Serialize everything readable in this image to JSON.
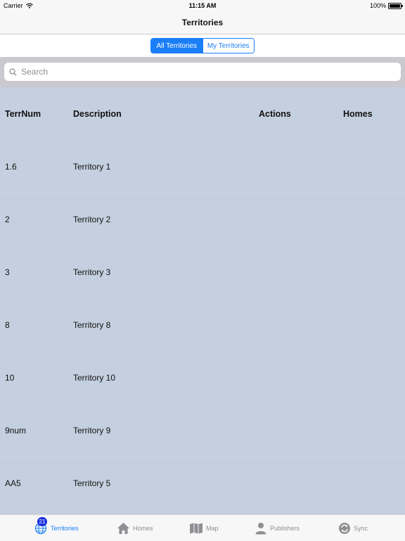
{
  "status_bar": {
    "carrier": "Carrier",
    "time": "11:15 AM",
    "battery": "100%"
  },
  "nav": {
    "title": "Territories"
  },
  "segments": [
    {
      "label": "All Territories",
      "selected": true
    },
    {
      "label": "My Territories",
      "selected": false
    }
  ],
  "search": {
    "placeholder": "Search",
    "value": ""
  },
  "table": {
    "headers": {
      "terrnum": "TerrNum",
      "description": "Description",
      "actions": "Actions",
      "homes": "Homes"
    },
    "rows": [
      {
        "terrnum": "1.6",
        "description": "Territory 1"
      },
      {
        "terrnum": "2",
        "description": "Territory 2"
      },
      {
        "terrnum": "3",
        "description": "Territory 3"
      },
      {
        "terrnum": "8",
        "description": "Territory 8"
      },
      {
        "terrnum": "10",
        "description": "Territory 10"
      },
      {
        "terrnum": "9num",
        "description": "Territory 9"
      },
      {
        "terrnum": "AA5",
        "description": "Territory 5"
      }
    ]
  },
  "tabs": [
    {
      "label": "Territories",
      "icon": "globe-icon",
      "badge": "21",
      "active": true
    },
    {
      "label": "Homes",
      "icon": "house-icon",
      "active": false
    },
    {
      "label": "Map",
      "icon": "map-icon",
      "active": false
    },
    {
      "label": "Publishers",
      "icon": "person-icon",
      "active": false
    },
    {
      "label": "Sync",
      "icon": "sync-icon",
      "active": false
    }
  ],
  "colors": {
    "accent": "#1a7ef7",
    "table_bg": "#c4d0df",
    "badge": "#1a2fe0"
  }
}
